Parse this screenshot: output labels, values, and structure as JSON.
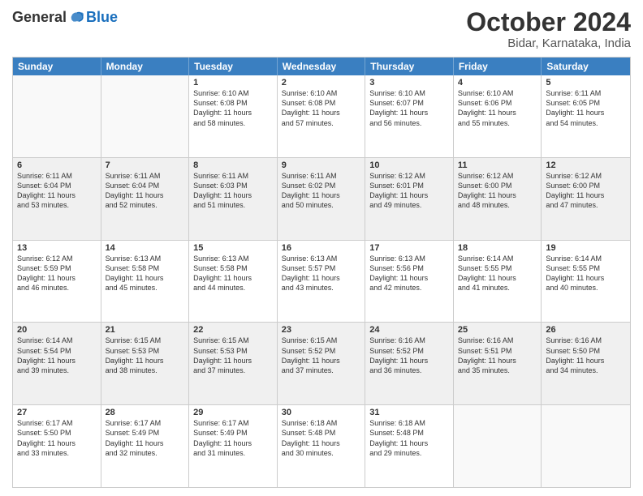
{
  "logo": {
    "general": "General",
    "blue": "Blue"
  },
  "title": "October 2024",
  "subtitle": "Bidar, Karnataka, India",
  "days": [
    "Sunday",
    "Monday",
    "Tuesday",
    "Wednesday",
    "Thursday",
    "Friday",
    "Saturday"
  ],
  "weeks": [
    [
      {
        "day": "",
        "lines": [],
        "empty": true
      },
      {
        "day": "",
        "lines": [],
        "empty": true
      },
      {
        "day": "1",
        "lines": [
          "Sunrise: 6:10 AM",
          "Sunset: 6:08 PM",
          "Daylight: 11 hours",
          "and 58 minutes."
        ],
        "empty": false
      },
      {
        "day": "2",
        "lines": [
          "Sunrise: 6:10 AM",
          "Sunset: 6:08 PM",
          "Daylight: 11 hours",
          "and 57 minutes."
        ],
        "empty": false
      },
      {
        "day": "3",
        "lines": [
          "Sunrise: 6:10 AM",
          "Sunset: 6:07 PM",
          "Daylight: 11 hours",
          "and 56 minutes."
        ],
        "empty": false
      },
      {
        "day": "4",
        "lines": [
          "Sunrise: 6:10 AM",
          "Sunset: 6:06 PM",
          "Daylight: 11 hours",
          "and 55 minutes."
        ],
        "empty": false
      },
      {
        "day": "5",
        "lines": [
          "Sunrise: 6:11 AM",
          "Sunset: 6:05 PM",
          "Daylight: 11 hours",
          "and 54 minutes."
        ],
        "empty": false
      }
    ],
    [
      {
        "day": "6",
        "lines": [
          "Sunrise: 6:11 AM",
          "Sunset: 6:04 PM",
          "Daylight: 11 hours",
          "and 53 minutes."
        ],
        "empty": false,
        "shaded": true
      },
      {
        "day": "7",
        "lines": [
          "Sunrise: 6:11 AM",
          "Sunset: 6:04 PM",
          "Daylight: 11 hours",
          "and 52 minutes."
        ],
        "empty": false,
        "shaded": true
      },
      {
        "day": "8",
        "lines": [
          "Sunrise: 6:11 AM",
          "Sunset: 6:03 PM",
          "Daylight: 11 hours",
          "and 51 minutes."
        ],
        "empty": false,
        "shaded": true
      },
      {
        "day": "9",
        "lines": [
          "Sunrise: 6:11 AM",
          "Sunset: 6:02 PM",
          "Daylight: 11 hours",
          "and 50 minutes."
        ],
        "empty": false,
        "shaded": true
      },
      {
        "day": "10",
        "lines": [
          "Sunrise: 6:12 AM",
          "Sunset: 6:01 PM",
          "Daylight: 11 hours",
          "and 49 minutes."
        ],
        "empty": false,
        "shaded": true
      },
      {
        "day": "11",
        "lines": [
          "Sunrise: 6:12 AM",
          "Sunset: 6:00 PM",
          "Daylight: 11 hours",
          "and 48 minutes."
        ],
        "empty": false,
        "shaded": true
      },
      {
        "day": "12",
        "lines": [
          "Sunrise: 6:12 AM",
          "Sunset: 6:00 PM",
          "Daylight: 11 hours",
          "and 47 minutes."
        ],
        "empty": false,
        "shaded": true
      }
    ],
    [
      {
        "day": "13",
        "lines": [
          "Sunrise: 6:12 AM",
          "Sunset: 5:59 PM",
          "Daylight: 11 hours",
          "and 46 minutes."
        ],
        "empty": false
      },
      {
        "day": "14",
        "lines": [
          "Sunrise: 6:13 AM",
          "Sunset: 5:58 PM",
          "Daylight: 11 hours",
          "and 45 minutes."
        ],
        "empty": false
      },
      {
        "day": "15",
        "lines": [
          "Sunrise: 6:13 AM",
          "Sunset: 5:58 PM",
          "Daylight: 11 hours",
          "and 44 minutes."
        ],
        "empty": false
      },
      {
        "day": "16",
        "lines": [
          "Sunrise: 6:13 AM",
          "Sunset: 5:57 PM",
          "Daylight: 11 hours",
          "and 43 minutes."
        ],
        "empty": false
      },
      {
        "day": "17",
        "lines": [
          "Sunrise: 6:13 AM",
          "Sunset: 5:56 PM",
          "Daylight: 11 hours",
          "and 42 minutes."
        ],
        "empty": false
      },
      {
        "day": "18",
        "lines": [
          "Sunrise: 6:14 AM",
          "Sunset: 5:55 PM",
          "Daylight: 11 hours",
          "and 41 minutes."
        ],
        "empty": false
      },
      {
        "day": "19",
        "lines": [
          "Sunrise: 6:14 AM",
          "Sunset: 5:55 PM",
          "Daylight: 11 hours",
          "and 40 minutes."
        ],
        "empty": false
      }
    ],
    [
      {
        "day": "20",
        "lines": [
          "Sunrise: 6:14 AM",
          "Sunset: 5:54 PM",
          "Daylight: 11 hours",
          "and 39 minutes."
        ],
        "empty": false,
        "shaded": true
      },
      {
        "day": "21",
        "lines": [
          "Sunrise: 6:15 AM",
          "Sunset: 5:53 PM",
          "Daylight: 11 hours",
          "and 38 minutes."
        ],
        "empty": false,
        "shaded": true
      },
      {
        "day": "22",
        "lines": [
          "Sunrise: 6:15 AM",
          "Sunset: 5:53 PM",
          "Daylight: 11 hours",
          "and 37 minutes."
        ],
        "empty": false,
        "shaded": true
      },
      {
        "day": "23",
        "lines": [
          "Sunrise: 6:15 AM",
          "Sunset: 5:52 PM",
          "Daylight: 11 hours",
          "and 37 minutes."
        ],
        "empty": false,
        "shaded": true
      },
      {
        "day": "24",
        "lines": [
          "Sunrise: 6:16 AM",
          "Sunset: 5:52 PM",
          "Daylight: 11 hours",
          "and 36 minutes."
        ],
        "empty": false,
        "shaded": true
      },
      {
        "day": "25",
        "lines": [
          "Sunrise: 6:16 AM",
          "Sunset: 5:51 PM",
          "Daylight: 11 hours",
          "and 35 minutes."
        ],
        "empty": false,
        "shaded": true
      },
      {
        "day": "26",
        "lines": [
          "Sunrise: 6:16 AM",
          "Sunset: 5:50 PM",
          "Daylight: 11 hours",
          "and 34 minutes."
        ],
        "empty": false,
        "shaded": true
      }
    ],
    [
      {
        "day": "27",
        "lines": [
          "Sunrise: 6:17 AM",
          "Sunset: 5:50 PM",
          "Daylight: 11 hours",
          "and 33 minutes."
        ],
        "empty": false
      },
      {
        "day": "28",
        "lines": [
          "Sunrise: 6:17 AM",
          "Sunset: 5:49 PM",
          "Daylight: 11 hours",
          "and 32 minutes."
        ],
        "empty": false
      },
      {
        "day": "29",
        "lines": [
          "Sunrise: 6:17 AM",
          "Sunset: 5:49 PM",
          "Daylight: 11 hours",
          "and 31 minutes."
        ],
        "empty": false
      },
      {
        "day": "30",
        "lines": [
          "Sunrise: 6:18 AM",
          "Sunset: 5:48 PM",
          "Daylight: 11 hours",
          "and 30 minutes."
        ],
        "empty": false
      },
      {
        "day": "31",
        "lines": [
          "Sunrise: 6:18 AM",
          "Sunset: 5:48 PM",
          "Daylight: 11 hours",
          "and 29 minutes."
        ],
        "empty": false
      },
      {
        "day": "",
        "lines": [],
        "empty": true
      },
      {
        "day": "",
        "lines": [],
        "empty": true
      }
    ]
  ]
}
